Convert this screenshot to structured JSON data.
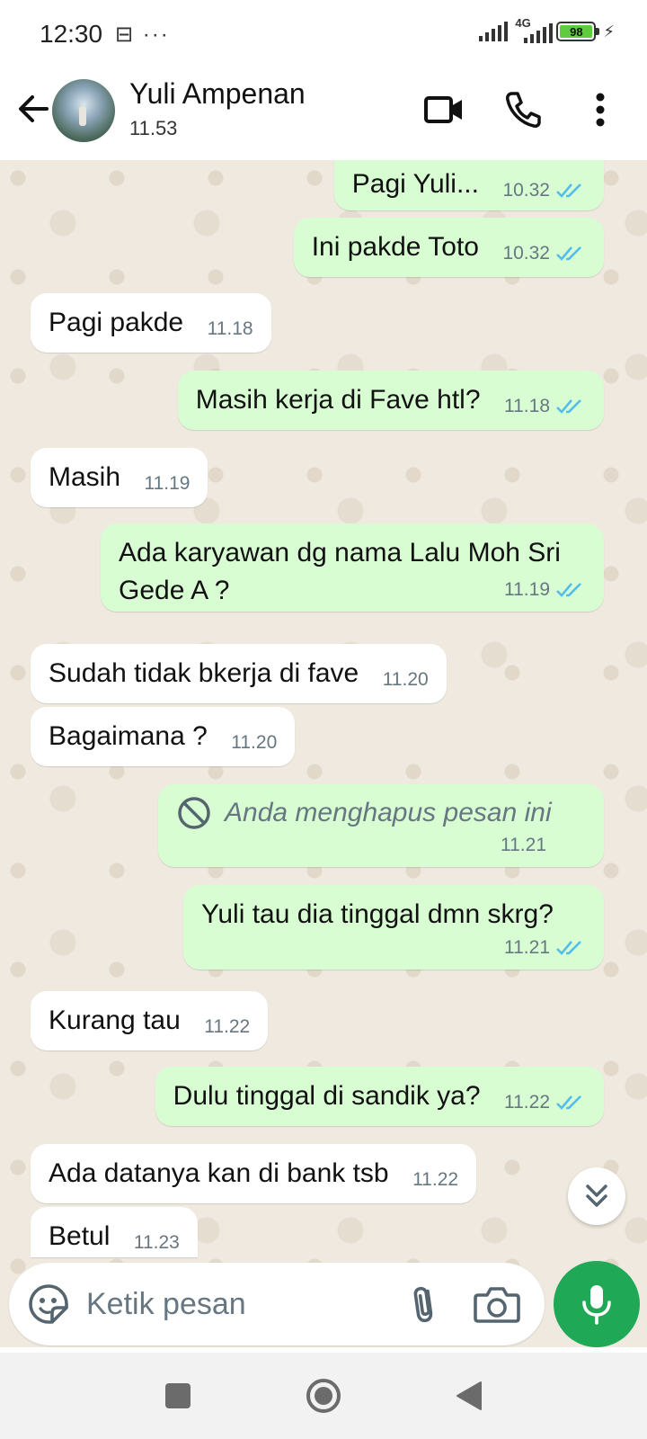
{
  "status_bar": {
    "time": "12:30",
    "left_icons": "⊟ ···",
    "network": "4G",
    "battery": "98"
  },
  "header": {
    "name": "Yuli Ampenan",
    "status": "11.53"
  },
  "messages": [
    {
      "dir": "out",
      "text": "Pagi Yuli...",
      "time": "10.32",
      "read": true
    },
    {
      "dir": "out",
      "text": "Ini pakde Toto",
      "time": "10.32",
      "read": true
    },
    {
      "dir": "in",
      "text": "Pagi pakde",
      "time": "11.18"
    },
    {
      "dir": "out",
      "text": "Masih kerja di Fave htl?",
      "time": "11.18",
      "read": true
    },
    {
      "dir": "in",
      "text": "Masih",
      "time": "11.19"
    },
    {
      "dir": "out",
      "text": "Ada karyawan dg nama Lalu Moh Sri Gede A ?",
      "time": "11.19",
      "read": true
    },
    {
      "dir": "in",
      "text": "Sudah tidak bkerja di fave",
      "time": "11.20"
    },
    {
      "dir": "in",
      "text": "Bagaimana ?",
      "time": "11.20"
    },
    {
      "dir": "out",
      "text": "Anda menghapus pesan ini",
      "time": "11.21",
      "deleted": true
    },
    {
      "dir": "out",
      "text": "Yuli tau dia tinggal dmn skrg?",
      "time": "11.21",
      "read": true
    },
    {
      "dir": "in",
      "text": "Kurang tau",
      "time": "11.22"
    },
    {
      "dir": "out",
      "text": "Dulu tinggal di sandik ya?",
      "time": "11.22",
      "read": true
    },
    {
      "dir": "in",
      "text": "Ada datanya kan di bank tsb",
      "time": "11.22"
    },
    {
      "dir": "in",
      "text": "Betul",
      "time": "11.23"
    }
  ],
  "composer": {
    "placeholder": "Ketik pesan"
  },
  "colors": {
    "outgoing_bubble": "#d9fdd3",
    "incoming_bubble": "#ffffff",
    "read_ticks": "#53bdeb",
    "mic_button": "#1fa855"
  },
  "icons": [
    "back-arrow-icon",
    "video-call-icon",
    "phone-icon",
    "more-vert-icon",
    "blocked-icon",
    "double-chevron-down-icon",
    "sticker-icon",
    "paperclip-icon",
    "camera-icon",
    "mic-icon",
    "nav-square-icon",
    "nav-circle-icon",
    "nav-triangle-icon"
  ]
}
